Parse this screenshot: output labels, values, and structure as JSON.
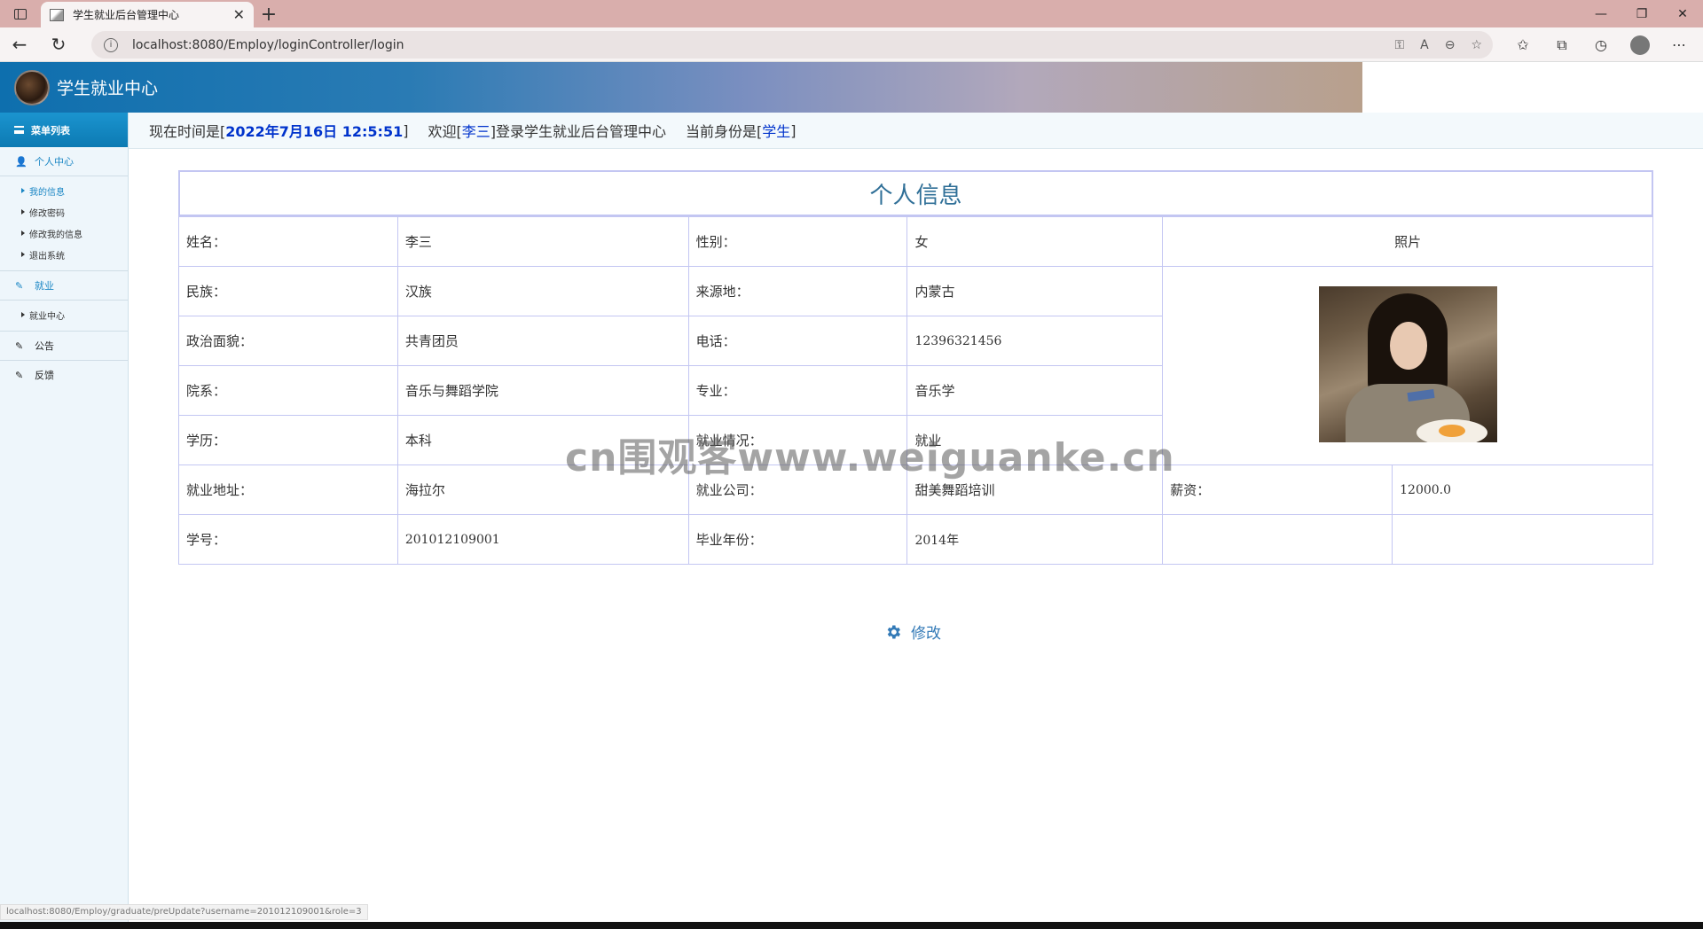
{
  "browser": {
    "tab_title": "学生就业后台管理中心",
    "url": "localhost:8080/Employ/loginController/login",
    "status_url": "localhost:8080/Employ/graduate/preUpdate?username=201012109001&role=3"
  },
  "header": {
    "title": "学生就业中心"
  },
  "sidebar": {
    "menu_title": "菜单列表",
    "groups": [
      {
        "label": "个人中心",
        "items": [
          "我的信息",
          "修改密码",
          "修改我的信息",
          "退出系统"
        ]
      },
      {
        "label": "就业",
        "items": [
          "就业中心"
        ]
      },
      {
        "label": "公告",
        "items": []
      },
      {
        "label": "反馈",
        "items": []
      }
    ]
  },
  "infobar": {
    "time_prefix": "现在时间是[",
    "time_value": "2022年7月16日 12:5:51",
    "time_suffix": "]",
    "welcome_prefix": "欢迎[",
    "user_name": "李三",
    "welcome_suffix": "]登录学生就业后台管理中心",
    "role_prefix": "当前身份是[",
    "role_value": "学生",
    "role_suffix": "]"
  },
  "profile": {
    "title": "个人信息",
    "photo_label": "照片",
    "rows": [
      [
        {
          "label": "姓名：",
          "value": "李三"
        },
        {
          "label": "性别：",
          "value": "女"
        }
      ],
      [
        {
          "label": "民族：",
          "value": "汉族"
        },
        {
          "label": "来源地：",
          "value": "内蒙古"
        }
      ],
      [
        {
          "label": "政治面貌：",
          "value": "共青团员"
        },
        {
          "label": "电话：",
          "value": "12396321456"
        }
      ],
      [
        {
          "label": "院系：",
          "value": "音乐与舞蹈学院"
        },
        {
          "label": "专业：",
          "value": "音乐学"
        }
      ],
      [
        {
          "label": "学历：",
          "value": "本科"
        },
        {
          "label": "就业情况：",
          "value": "就业"
        }
      ],
      [
        {
          "label": "就业地址：",
          "value": "海拉尔"
        },
        {
          "label": "就业公司：",
          "value": "甜美舞蹈培训"
        },
        {
          "label": "薪资：",
          "value": "12000.0"
        }
      ],
      [
        {
          "label": "学号：",
          "value": "201012109001"
        },
        {
          "label": "毕业年份：",
          "value": "2014年"
        }
      ]
    ],
    "edit_label": "修改"
  },
  "watermark": "cn围观客www.weiguanke.cn"
}
